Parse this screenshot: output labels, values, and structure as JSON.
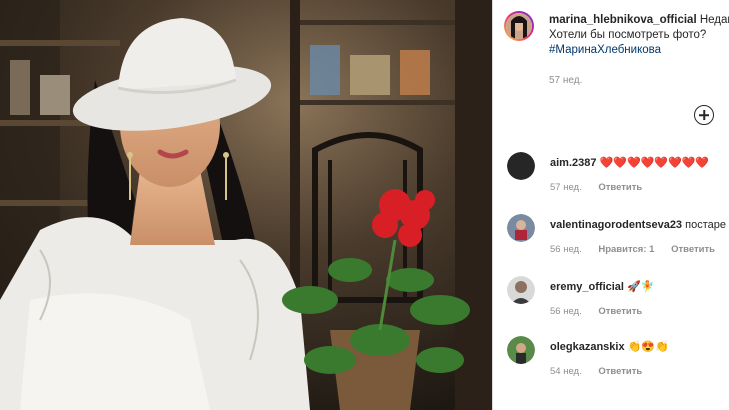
{
  "post": {
    "author": "marina_hlebnikova_official",
    "caption_start": "Недавн",
    "caption_line2": "Хотели бы посмотреть фото?",
    "hashtag": "#МаринаХлебникова",
    "time": "57 нед."
  },
  "comments": [
    {
      "username": "aim.2387",
      "text": "❤️❤️❤️❤️❤️❤️❤️❤️",
      "time": "57 нед.",
      "likes": "",
      "reply": "Ответить"
    },
    {
      "username": "valentinagorodentseva23",
      "text": "постаре",
      "time": "56 нед.",
      "likes": "Нравится: 1",
      "reply": "Ответить"
    },
    {
      "username": "eremy_official",
      "text": "🚀🧚",
      "time": "56 нед.",
      "likes": "",
      "reply": "Ответить"
    },
    {
      "username": "olegkazanskix",
      "text": "👏😍👏",
      "time": "54 нед.",
      "likes": "",
      "reply": "Ответить"
    }
  ],
  "icons": {
    "add": "plus-circle-icon"
  }
}
